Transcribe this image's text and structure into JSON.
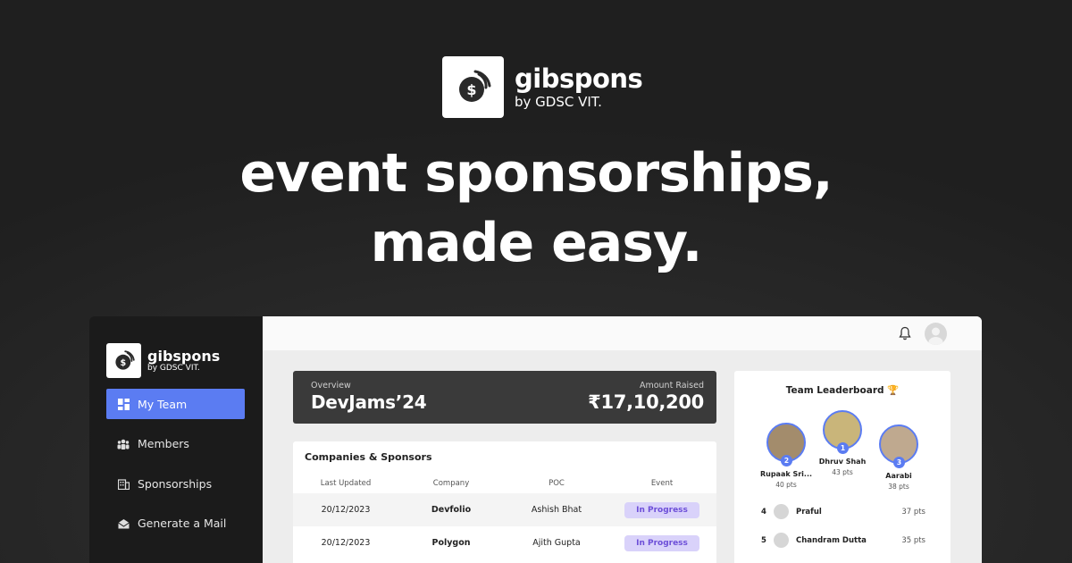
{
  "brand": {
    "name": "gibspons",
    "by": "by GDSC VIT."
  },
  "hero": {
    "line1": "event sponsorships,",
    "line2": "made easy."
  },
  "sidebar": {
    "brand_name": "gibspons",
    "brand_by": "by GDSC VIT.",
    "items": [
      {
        "label": "My Team",
        "icon": "grid-icon",
        "active": true
      },
      {
        "label": "Members",
        "icon": "people-icon",
        "active": false
      },
      {
        "label": "Sponsorships",
        "icon": "building-icon",
        "active": false
      },
      {
        "label": "Generate a Mail",
        "icon": "mail-icon",
        "active": false
      }
    ]
  },
  "overview": {
    "label": "Overview",
    "title": "DevJams’24",
    "amount_label": "Amount Raised",
    "amount": "₹17,10,200"
  },
  "companies": {
    "title": "Companies & Sponsors",
    "columns": [
      "Last Updated",
      "Company",
      "POC",
      "Event"
    ],
    "rows": [
      {
        "date": "20/12/2023",
        "company": "Devfolio",
        "poc": "Ashish Bhat",
        "status": "In Progress"
      },
      {
        "date": "20/12/2023",
        "company": "Polygon",
        "poc": "Ajith Gupta",
        "status": "In Progress"
      }
    ]
  },
  "leaderboard": {
    "title": "Team Leaderboard 🏆",
    "podium": [
      {
        "rank": "2",
        "name": "Rupaak Sri...",
        "pts": "40 pts"
      },
      {
        "rank": "1",
        "name": "Dhruv Shah",
        "pts": "43 pts"
      },
      {
        "rank": "3",
        "name": "Aarabi",
        "pts": "38 pts"
      }
    ],
    "rows": [
      {
        "rank": "4",
        "name": "Praful",
        "pts": "37 pts"
      },
      {
        "rank": "5",
        "name": "Chandram Dutta",
        "pts": "35 pts"
      }
    ]
  },
  "colors": {
    "accent": "#5b7cf2",
    "pill_bg": "#d9d2fa",
    "pill_text": "#6d4fd8"
  }
}
